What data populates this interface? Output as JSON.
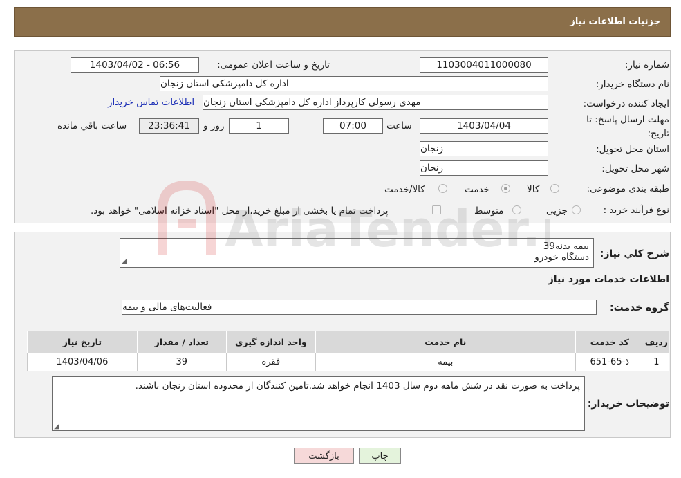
{
  "header": {
    "title": "جزئیات اطلاعات نیاز"
  },
  "form": {
    "need_number_label": "شماره نیاز:",
    "need_number": "1103004011000080",
    "announce_label": "تاریخ و ساعت اعلان عمومی:",
    "announce_value": "1403/04/02 - 06:56",
    "buyer_org_label": "نام دستگاه خریدار:",
    "buyer_org": "اداره کل دامپزشکی استان زنجان",
    "requester_label": "ایجاد کننده درخواست:",
    "requester": "مهدی رسولی کارپرداز اداره کل دامپزشکی استان زنجان",
    "contact_link": "اطلاعات تماس خریدار",
    "deadline_label": "مهلت ارسال پاسخ: تا تاریخ:",
    "deadline_date": "1403/04/04",
    "time_label": "ساعت",
    "deadline_time": "07:00",
    "days_value": "1",
    "days_label": "روز و",
    "remaining_time": "23:36:41",
    "remaining_label": "ساعت باقي مانده",
    "province_label": "استان محل تحویل:",
    "province": "زنجان",
    "city_label": "شهر محل تحویل:",
    "city": "زنجان",
    "category_label": "طبقه بندی موضوعی:",
    "category_options": [
      "کالا",
      "خدمت",
      "کالا/خدمت"
    ],
    "category_selected": "خدمت",
    "purchase_type_label": "نوع فرآیند خرید :",
    "purchase_options": [
      "جزیی",
      "متوسط"
    ],
    "purchase_note": "پرداخت تمام یا بخشی از مبلغ خرید،از محل \"اسناد خزانه اسلامی\" خواهد بود."
  },
  "details": {
    "summary_label": "شرح کلي نیاز:",
    "summary_line1": "بیمه بدنه39",
    "summary_line2": "دستگاه خودرو",
    "services_title": "اطلاعات خدمات مورد نیاز",
    "service_group_label": "گروه خدمت:",
    "service_group": "فعالیت‌های مالی و بیمه",
    "table": {
      "headers": [
        "ردیف",
        "کد خدمت",
        "نام خدمت",
        "واحد اندازه گیری",
        "تعداد / مقدار",
        "تاریخ نیاز"
      ],
      "rows": [
        [
          "1",
          "ذ-65-651",
          "بیمه",
          "فقره",
          "39",
          "1403/04/06"
        ]
      ]
    },
    "buyer_notes_label": "توضیحات خریدار:",
    "buyer_notes": "پرداخت به صورت نقد در شش ماهه دوم سال 1403 انجام خواهد شد.تامین کنندگان از محدوده استان زنجان باشند."
  },
  "buttons": {
    "print": "چاپ",
    "back": "بازگشت"
  },
  "watermark": {
    "text": "AriaTender.net"
  },
  "colors": {
    "header_bg": "#8b6f4a",
    "back_btn_bg": "#f6d9d9",
    "print_btn_bg": "#e4f3dc",
    "link": "#1a2db5"
  }
}
